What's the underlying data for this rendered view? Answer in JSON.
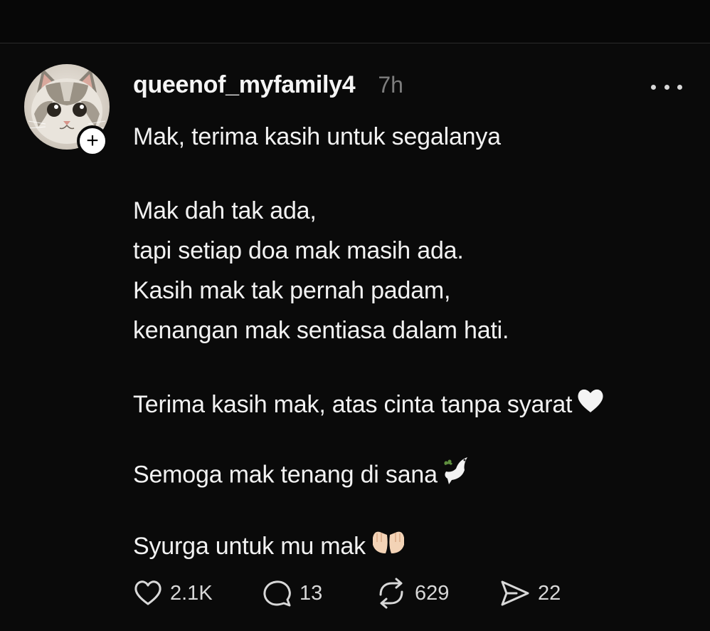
{
  "post": {
    "username": "queenof_myfamily4",
    "timestamp": "7h",
    "avatar_icon": "cat-avatar-icon",
    "follow_badge": "+",
    "title": "Mak, terima kasih untuk segalanya",
    "stanza_1": [
      "Mak dah tak ada,",
      "tapi setiap doa mak masih ada.",
      "Kasih mak tak pernah padam,",
      "kenangan mak sentiasa dalam hati."
    ],
    "line_thanks": "Terima kasih mak, atas cinta tanpa syarat",
    "line_peace": "Semoga mak tenang di sana",
    "line_heaven": "Syurga untuk mu mak",
    "emojis": {
      "thanks": "white-heart-icon",
      "peace": "dove-icon",
      "heaven": "palms-up-together-icon"
    }
  },
  "actions": {
    "likes": "2.1K",
    "replies": "13",
    "reposts": "629",
    "shares": "22"
  },
  "colors": {
    "background": "#0a0a0a",
    "text": "#f2f2f2",
    "muted": "#7d7d7d"
  }
}
